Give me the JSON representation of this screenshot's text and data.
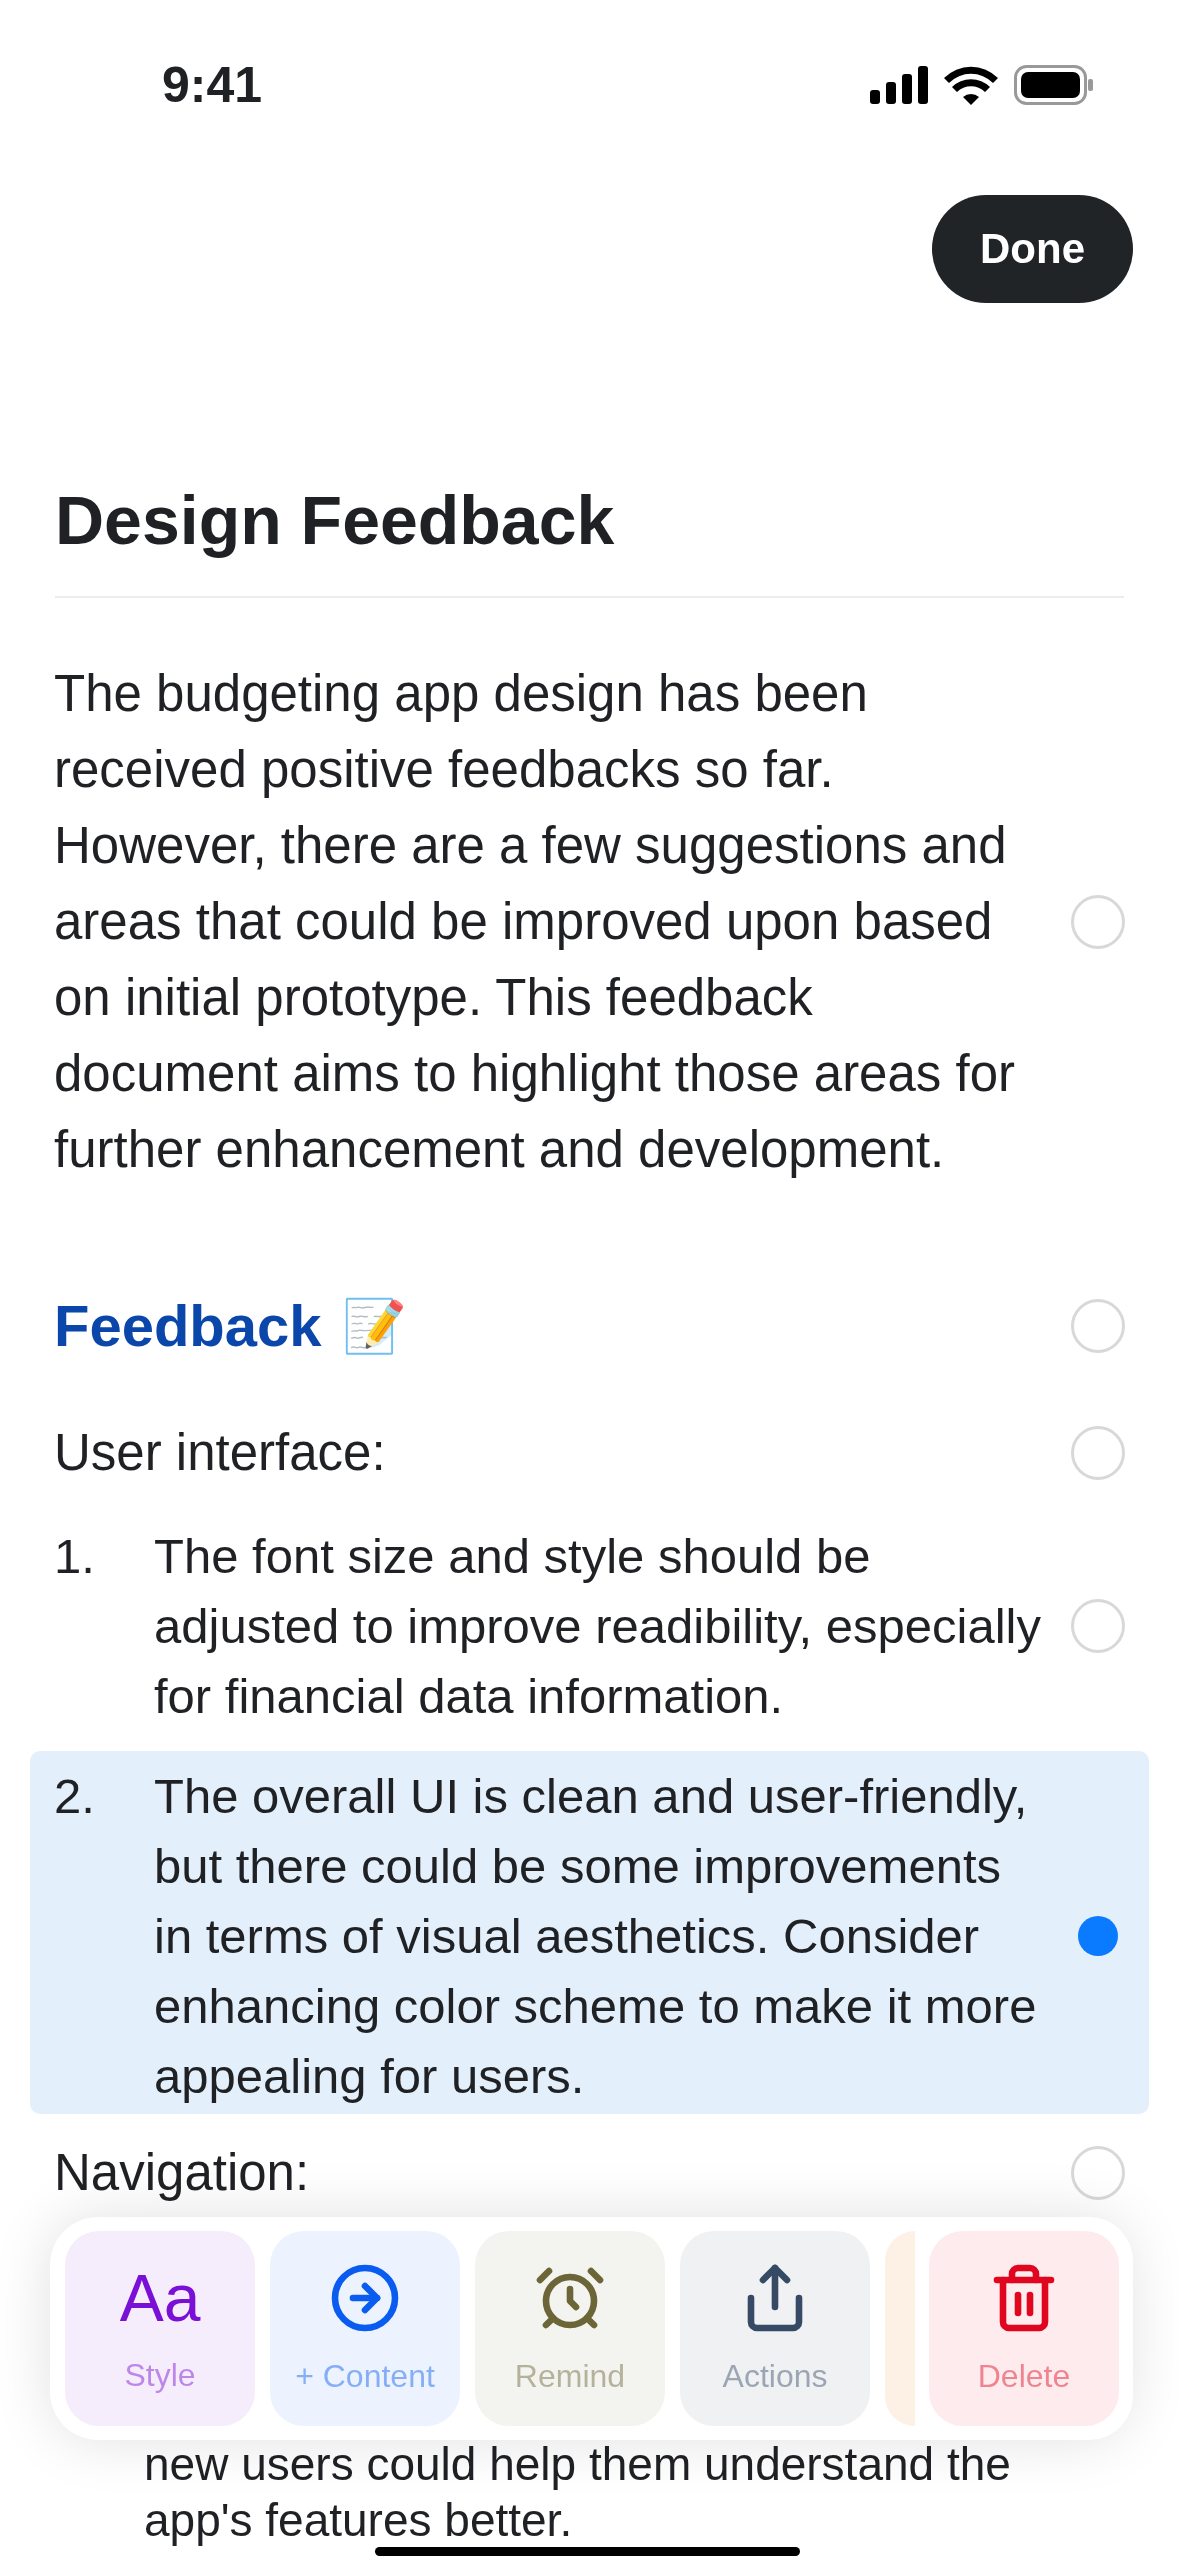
{
  "status_bar": {
    "time": "9:41"
  },
  "done_button": "Done",
  "title": "Design Feedback",
  "blocks": [
    {
      "kind": "paragraph",
      "text": "The budgeting app design has been received positive feedbacks so far. However, there are a few suggestions and areas that could be improved upon based on initial prototype. This feedback document aims to highlight those areas for further enhancement and development.",
      "selected": false
    },
    {
      "kind": "heading",
      "text": "Feedback",
      "emoji": "📝",
      "selected": false
    },
    {
      "kind": "label",
      "text": "User interface:",
      "selected": false
    },
    {
      "kind": "list_item",
      "number": "1.",
      "text": "The font size and style should be adjusted to improve readibility, especially for financial data information.",
      "selected": false
    },
    {
      "kind": "list_item",
      "number": "2.",
      "text": "The overall UI is clean and user-friendly, but there could be some improvements in terms of visual aesthetics. Consider enhancing color scheme to make it more appealing for users.",
      "selected": true
    },
    {
      "kind": "label",
      "text": "Navigation:",
      "selected": false
    },
    {
      "kind": "continuation",
      "text": "new users could help them understand the app's features better."
    }
  ],
  "toolbar": [
    {
      "kind": "style",
      "label": "Style",
      "glyph": "Aa",
      "color": "#7a0fd6"
    },
    {
      "kind": "content",
      "label": "+ Content",
      "color": "#0a5cf0"
    },
    {
      "kind": "remind",
      "label": "Remind",
      "color": "#6b6538"
    },
    {
      "kind": "actions",
      "label": "Actions",
      "color": "#364a66"
    },
    {
      "kind": "delete",
      "label": "Delete",
      "color": "#e0061f"
    }
  ]
}
